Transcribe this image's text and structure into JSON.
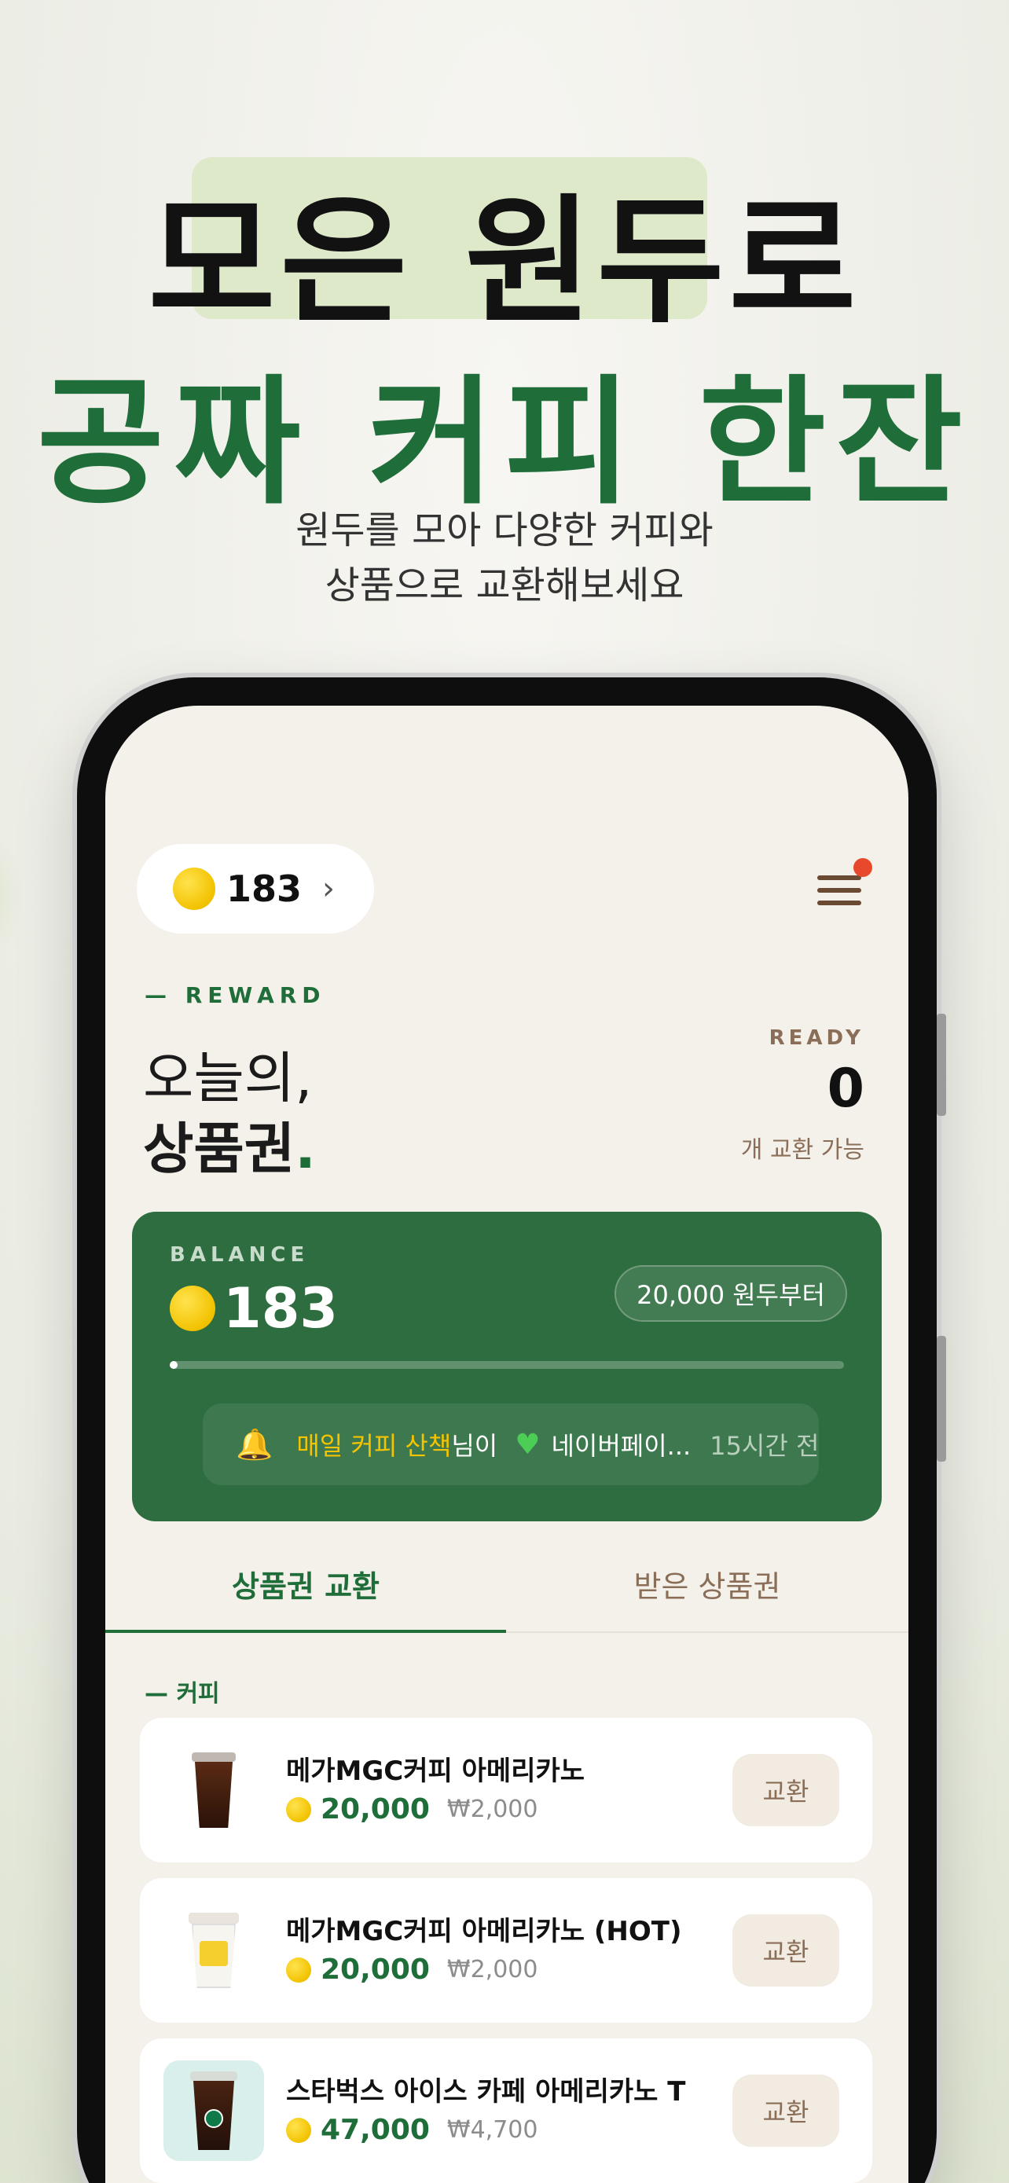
{
  "hero": {
    "line1": "모은 원두로",
    "line2": "공짜 커피 한잔",
    "sub1": "원두를 모아 다양한 커피와",
    "sub2": "상품으로 교환해보세요"
  },
  "header": {
    "coin_balance": "183",
    "chevron": "›",
    "menu_icon": "hamburger-icon",
    "notification_dot": true
  },
  "reward": {
    "label": "— REWARD",
    "title1": "오늘의,",
    "title2": "상품권",
    "title2_dot": ".",
    "ready_label": "READY",
    "ready_count": "0",
    "ready_sub": "개 교환 가능"
  },
  "balance_card": {
    "label": "BALANCE",
    "value": "183",
    "from_pill": "20,000 원두부터",
    "progress": 0.0092,
    "notice": {
      "icon": "bell-icon",
      "name": "매일 커피 산책",
      "suffix": "님이",
      "heart_icon": "green-heart-icon",
      "target": "네이버페이...",
      "time": "15시간 전"
    }
  },
  "tabs": [
    {
      "label": "상품권 교환",
      "active": true
    },
    {
      "label": "받은 상품권",
      "active": false
    }
  ],
  "section": {
    "label": "— 커피"
  },
  "products": [
    {
      "name": "메가MGC커피 아메리카노",
      "price": "20,000",
      "won": "₩2,000",
      "button": "교환",
      "thumb": "iced-coffee"
    },
    {
      "name": "메가MGC커피 아메리카노 (HOT)",
      "price": "20,000",
      "won": "₩2,000",
      "button": "교환",
      "thumb": "hot-coffee"
    },
    {
      "name": "스타벅스 아이스 카페 아메리카노 T",
      "price": "47,000",
      "won": "₩4,700",
      "button": "교환",
      "thumb": "starbucks-iced"
    }
  ],
  "colors": {
    "brand_green": "#1f6e3a",
    "card_green": "#2e6d3f",
    "highlight": "#dde9c9",
    "coin_gold": "#f2c200",
    "accent_brown": "#8a6e58"
  }
}
